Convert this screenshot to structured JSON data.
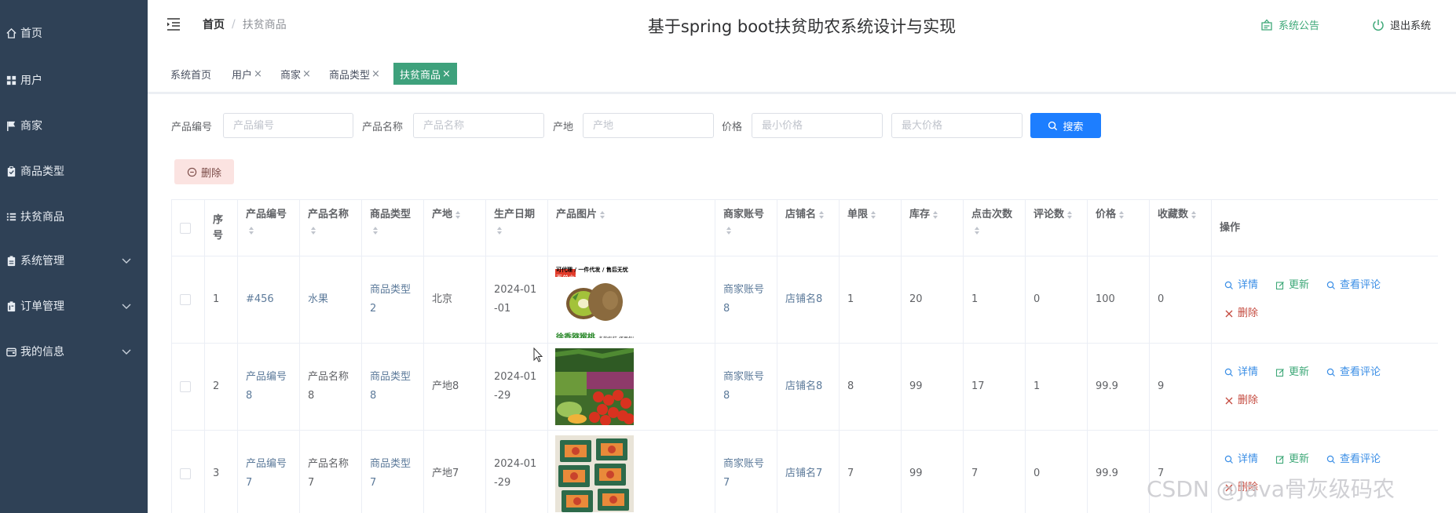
{
  "sidebar": {
    "items": [
      {
        "label": "首页",
        "icon": "home-icon"
      },
      {
        "label": "用户",
        "icon": "grid-icon"
      },
      {
        "label": "商家",
        "icon": "flag-icon"
      },
      {
        "label": "商品类型",
        "icon": "clipboard-icon"
      },
      {
        "label": "扶贫商品",
        "icon": "list-icon"
      },
      {
        "label": "系统管理",
        "icon": "document-icon",
        "expandable": true
      },
      {
        "label": "订单管理",
        "icon": "order-icon",
        "expandable": true
      },
      {
        "label": "我的信息",
        "icon": "wallet-icon",
        "expandable": true
      }
    ]
  },
  "header": {
    "breadcrumb_home": "首页",
    "breadcrumb_separator": "/",
    "breadcrumb_current": "扶贫商品",
    "title": "基于spring boot扶贫助农系统设计与实现",
    "notice_label": "系统公告",
    "logout_label": "退出系统"
  },
  "tabs": [
    {
      "label": "系统首页",
      "closable": false
    },
    {
      "label": "用户",
      "closable": true
    },
    {
      "label": "商家",
      "closable": true
    },
    {
      "label": "商品类型",
      "closable": true
    },
    {
      "label": "扶贫商品",
      "closable": true,
      "active": true
    }
  ],
  "tab_close_glyph": "×",
  "filter": {
    "code_label": "产品编号",
    "code_placeholder": "产品编号",
    "name_label": "产品名称",
    "name_placeholder": "产品名称",
    "origin_label": "产地",
    "origin_placeholder": "产地",
    "price_label": "价格",
    "min_price_placeholder": "最小价格",
    "max_price_placeholder": "最大价格",
    "search_label": "搜索"
  },
  "delete_label": "删除",
  "table": {
    "columns": [
      "",
      "序号",
      "产品编号",
      "产品名称",
      "商品类型",
      "产地",
      "生产日期",
      "产品图片",
      "商家账号",
      "店铺名",
      "单限",
      "库存",
      "点击次数",
      "评论数",
      "价格",
      "收藏数",
      "操作"
    ],
    "rows": [
      {
        "index": "1",
        "code": "#456",
        "name": "水果",
        "type": "商品类型2",
        "origin": "北京",
        "date": "2024-01-01",
        "image": "kiwi",
        "account": "商家账号8",
        "shop": "店铺名8",
        "limit": "1",
        "stock": "20",
        "clicks": "1",
        "reviews": "0",
        "price": "100",
        "favorites": "0"
      },
      {
        "index": "2",
        "code": "产品编号8",
        "name": "产品名称8",
        "type": "商品类型8",
        "origin": "产地8",
        "date": "2024-01-29",
        "image": "vegetables",
        "account": "商家账号8",
        "shop": "店铺名8",
        "limit": "8",
        "stock": "99",
        "clicks": "17",
        "reviews": "1",
        "price": "99.9",
        "favorites": "9"
      },
      {
        "index": "3",
        "code": "产品编号7",
        "name": "产品名称7",
        "type": "商品类型7",
        "origin": "产地7",
        "date": "2024-01-29",
        "image": "packages",
        "account": "商家账号7",
        "shop": "店铺名7",
        "limit": "7",
        "stock": "99",
        "clicks": "7",
        "reviews": "0",
        "price": "99.9",
        "favorites": "7"
      }
    ],
    "ops": {
      "detail": "详情",
      "update": "更新",
      "review": "查看评论",
      "delete": "删除"
    }
  },
  "image_texts": {
    "kiwi_top": "可代理 / 一件代发 / 售后无忧",
    "kiwi_badge": "百单立减",
    "kiwi_bottom": "徐香猕猴桃",
    "kiwi_bottom_small": "多款包装 坏果包赔"
  },
  "watermark": "CSDN @Java骨灰级码农",
  "colors": {
    "sidebar": "#2f4156",
    "accent": "#3ea17c",
    "primary": "#1d7eff"
  }
}
